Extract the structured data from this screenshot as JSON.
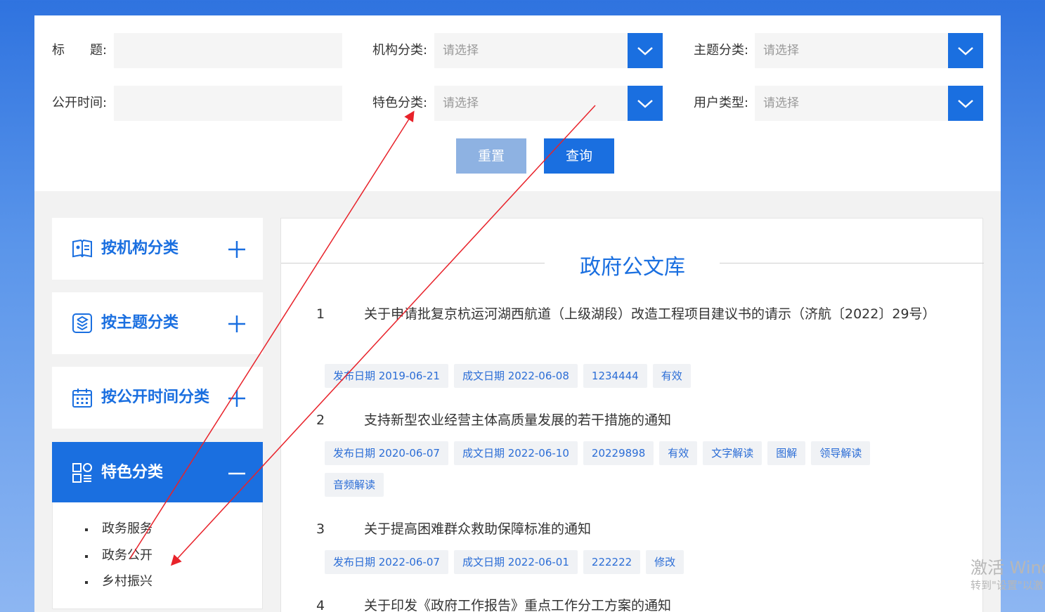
{
  "search": {
    "title_label": "标　　题:",
    "org_label": "机构分类:",
    "topic_label": "主题分类:",
    "time_label": "公开时间:",
    "feature_label": "特色分类:",
    "user_label": "用户类型:",
    "select_placeholder": "请选择",
    "reset_label": "重置",
    "query_label": "查询"
  },
  "sidebar": {
    "items": [
      {
        "label": "按机构分类",
        "icon": "book-icon"
      },
      {
        "label": "按主题分类",
        "icon": "layers-icon"
      },
      {
        "label": "按公开时间分类",
        "icon": "calendar-icon"
      },
      {
        "label": "特色分类",
        "icon": "grid-icon"
      }
    ],
    "sub_items": [
      "政务服务",
      "政务公开",
      "乡村振兴"
    ]
  },
  "main": {
    "title": "政府公文库",
    "docs": [
      {
        "num": "1",
        "title": "关于申请批复京杭运河湖西航道（上级湖段）改造工程项目建议书的请示（济航〔2022〕29号）",
        "tags": [
          "发布日期 2019-06-21",
          "成文日期 2022-06-08",
          "1234444",
          "有效"
        ]
      },
      {
        "num": "2",
        "title": "支持新型农业经营主体高质量发展的若干措施的通知",
        "tags": [
          "发布日期 2020-06-07",
          "成文日期 2022-06-10",
          "20229898",
          "有效",
          "文字解读",
          "图解",
          "领导解读",
          "音频解读"
        ]
      },
      {
        "num": "3",
        "title": "关于提高困难群众救助保障标准的通知",
        "tags": [
          "发布日期 2022-06-07",
          "成文日期 2022-06-01",
          "222222",
          "修改"
        ]
      },
      {
        "num": "4",
        "title": "关于印发《政府工作报告》重点工作分工方案的通知",
        "tags": []
      }
    ]
  },
  "watermark": {
    "line1": "激活 Wind",
    "line2": "转到\"设置\"以激"
  },
  "colors": {
    "accent": "#1a6fe0",
    "reset": "#8eb2e2",
    "annotation": "#e8222a"
  }
}
